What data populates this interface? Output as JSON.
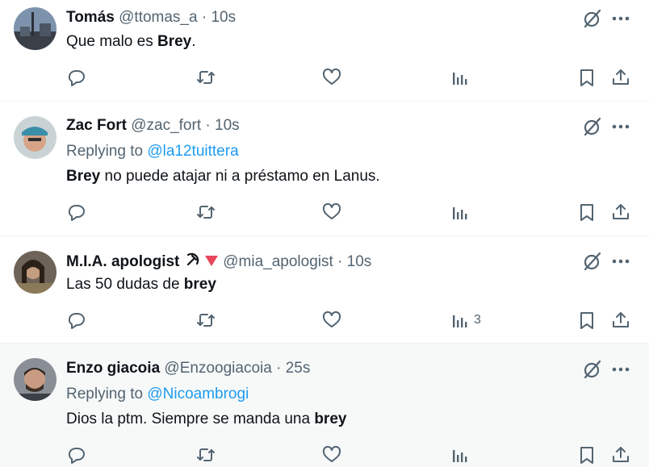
{
  "tweets": [
    {
      "name": "Tomás",
      "handle": "@ttomas_a",
      "dot": "·",
      "time": "10s",
      "replying_prefix": "",
      "replying_to": "",
      "text_before": "Que malo es ",
      "text_bold": "Brey",
      "text_after": ".",
      "view_count": ""
    },
    {
      "name": "Zac Fort",
      "handle": "@zac_fort",
      "dot": "·",
      "time": "10s",
      "replying_prefix": "Replying to ",
      "replying_to": "@la12tuittera",
      "text_before": "",
      "text_bold": "Brey",
      "text_after": " no puede atajar ni a préstamo en Lanus.",
      "view_count": ""
    },
    {
      "name": "M.I.A. apologist",
      "handle": "@mia_apologist",
      "dot": "·",
      "time": "10s",
      "emoji_icons": [
        "hammer-sickle-icon",
        "red-triangle-down-icon"
      ],
      "replying_prefix": "",
      "replying_to": "",
      "text_before": "Las 50 dudas de ",
      "text_bold": "brey",
      "text_after": "",
      "view_count": "3"
    },
    {
      "name": "Enzo giacoia",
      "handle": "@Enzoogiacoia",
      "dot": "·",
      "time": "25s",
      "replying_prefix": "Replying to ",
      "replying_to": "@Nicoambrogi",
      "text_before": "Dios la ptm. Siempre se manda una ",
      "text_bold": "brey",
      "text_after": "",
      "view_count": ""
    }
  ],
  "colors": {
    "secondary": "#536471",
    "link": "#1d9bf0",
    "highlight_bg": "#f7f9f9",
    "divider": "#eff3f4"
  }
}
